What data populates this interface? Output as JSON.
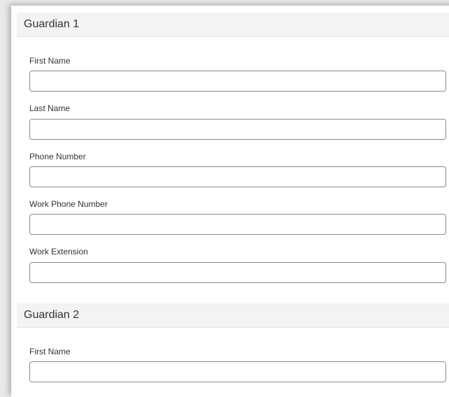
{
  "guardian1": {
    "title": "Guardian 1",
    "fields": [
      {
        "label": "First Name",
        "value": ""
      },
      {
        "label": "Last Name",
        "value": ""
      },
      {
        "label": "Phone Number",
        "value": ""
      },
      {
        "label": "Work Phone Number",
        "value": ""
      },
      {
        "label": "Work Extension",
        "value": ""
      }
    ]
  },
  "guardian2": {
    "title": "Guardian 2",
    "fields": [
      {
        "label": "First Name",
        "value": ""
      }
    ]
  }
}
